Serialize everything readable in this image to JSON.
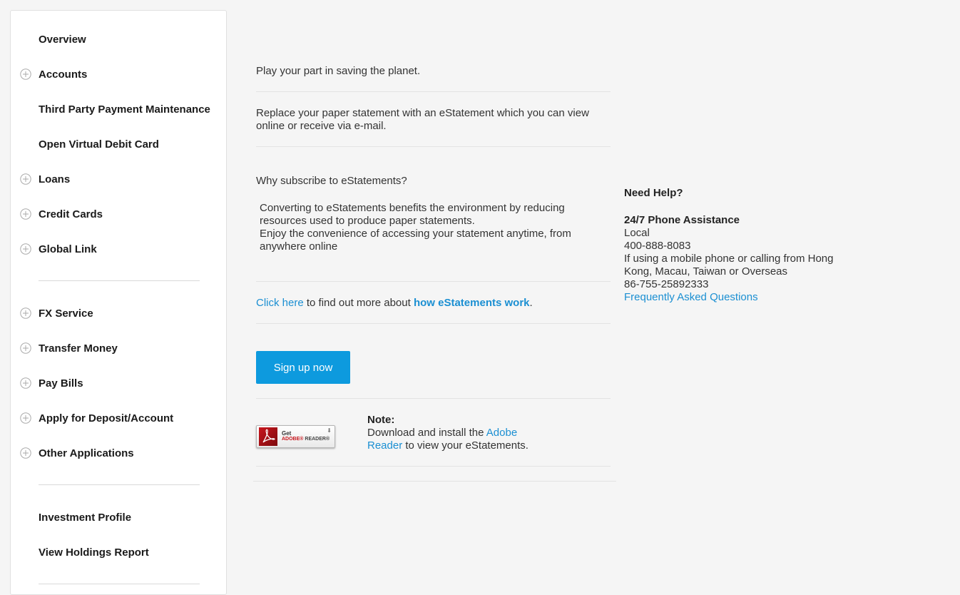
{
  "sidebar": {
    "items": [
      {
        "label": "Overview",
        "expandable": false
      },
      {
        "label": "Accounts",
        "expandable": true
      },
      {
        "label": "Third Party Payment Maintenance",
        "expandable": false
      },
      {
        "label": "Open Virtual Debit Card",
        "expandable": false
      },
      {
        "label": "Loans",
        "expandable": true
      },
      {
        "label": "Credit Cards",
        "expandable": true
      },
      {
        "label": "Global Link",
        "expandable": true
      },
      {
        "label": "FX Service",
        "expandable": true
      },
      {
        "label": "Transfer Money",
        "expandable": true
      },
      {
        "label": "Pay Bills",
        "expandable": true
      },
      {
        "label": "Apply for Deposit/Account",
        "expandable": true
      },
      {
        "label": "Other Applications",
        "expandable": true
      },
      {
        "label": "Investment Profile",
        "expandable": false
      },
      {
        "label": "View Holdings Report",
        "expandable": false
      }
    ]
  },
  "main": {
    "tagline": "Play your part in saving the planet.",
    "intro": "Replace your paper statement with an eStatement which you can view online or receive via e-mail.",
    "why_heading": "Why subscribe to eStatements?",
    "benefits": [
      "Converting to eStatements benefits the environment by reducing resources used to produce paper statements.",
      "Enjoy the convenience of accessing your statement anytime, from anywhere online"
    ],
    "more_info": {
      "click_here": "Click here",
      "middle": " to find out more about ",
      "how_link": "how eStatements work",
      "end": "."
    },
    "signup_button": "Sign up now",
    "adobe_badge": {
      "get": "Get",
      "brand": "ADOBE",
      "product": "READER"
    },
    "note": {
      "title": "Note:",
      "prefix": "Download and install the ",
      "link": "Adobe Reader",
      "suffix": " to view your eStatements."
    }
  },
  "help": {
    "title": "Need Help?",
    "phone_heading": "24/7 Phone Assistance",
    "local_label": "Local",
    "local_number": "400-888-8083",
    "overseas_label": "If using a mobile phone or calling from Hong Kong, Macau, Taiwan or Overseas",
    "overseas_number": "86-755-25892333",
    "faq_link": "Frequently Asked Questions"
  },
  "colors": {
    "accent": "#0d9ade",
    "link": "#1b8fd2",
    "background": "#f5f5f5"
  }
}
